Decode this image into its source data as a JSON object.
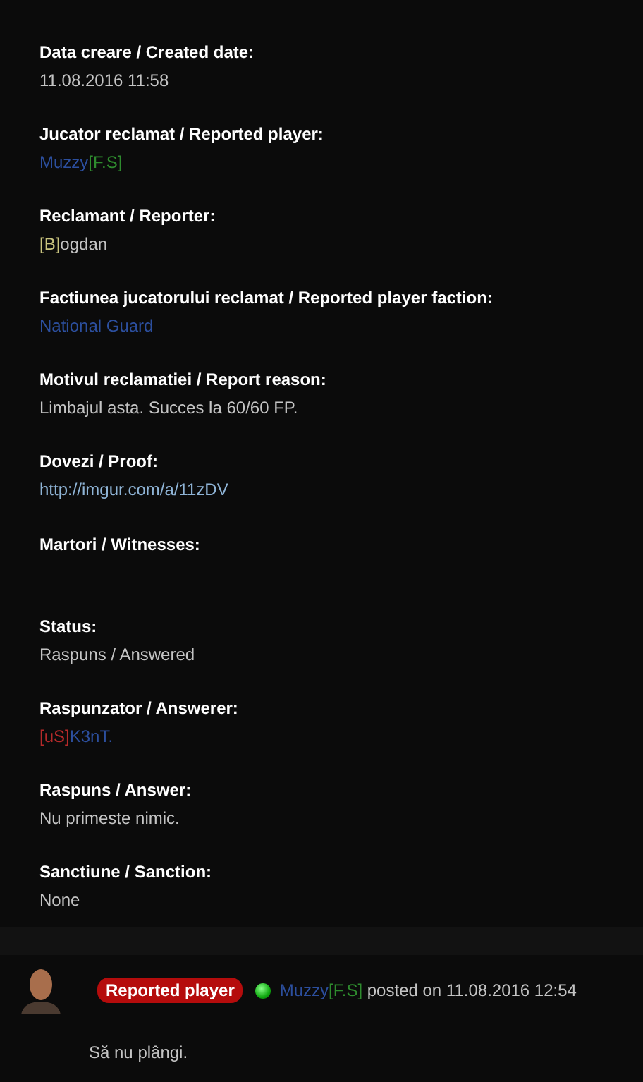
{
  "fields": [
    {
      "label": "Data creare / Created date:",
      "value": [
        {
          "text": "11.08.2016 11:58",
          "color": "#c4c4c4"
        }
      ]
    },
    {
      "label": "Jucator reclamat / Reported player:",
      "value": [
        {
          "text": "Muzzy",
          "color": "#2c4f9e"
        },
        {
          "text": "[F.S]",
          "color": "#2e8b2e"
        }
      ]
    },
    {
      "label": "Reclamant / Reporter:",
      "value": [
        {
          "text": "[B]",
          "color": "#c9c47f"
        },
        {
          "text": "ogdan",
          "color": "#c4c4c4"
        }
      ]
    },
    {
      "label": "Factiunea jucatorului reclamat / Reported player faction:",
      "value": [
        {
          "text": "National Guard",
          "color": "#2c4f9e"
        }
      ]
    },
    {
      "label": "Motivul reclamatiei / Report reason:",
      "value": [
        {
          "text": "Limbajul asta. Succes la 60/60 FP.",
          "color": "#c4c4c4"
        }
      ]
    },
    {
      "label": "Dovezi / Proof:",
      "value": [
        {
          "text": "http://imgur.com/a/11zDV",
          "color": "#8fb4d6"
        }
      ]
    },
    {
      "label": "Martori / Witnesses:"
    },
    {
      "label": "Status:",
      "value": [
        {
          "text": "Raspuns / Answered",
          "color": "#c4c4c4"
        }
      ]
    },
    {
      "label": "Raspunzator / Answerer:",
      "value": [
        {
          "text": "[uS]",
          "color": "#b52a2a"
        },
        {
          "text": "K3nT.",
          "color": "#2c4f9e"
        }
      ]
    },
    {
      "label": "Raspuns / Answer:",
      "value": [
        {
          "text": "Nu primeste nimic.",
          "color": "#c4c4c4"
        }
      ]
    },
    {
      "label": "Sanctiune / Sanction:",
      "value": [
        {
          "text": "None",
          "color": "#c4c4c4"
        }
      ]
    }
  ],
  "comment": {
    "badge": "Reported player",
    "online": true,
    "author": [
      {
        "text": "Muzzy",
        "color": "#2c4f9e"
      },
      {
        "text": "[F.S]",
        "color": "#2e8b2e"
      }
    ],
    "posted": "posted on 11.08.2016 12:54",
    "body": "Să nu plângi."
  }
}
